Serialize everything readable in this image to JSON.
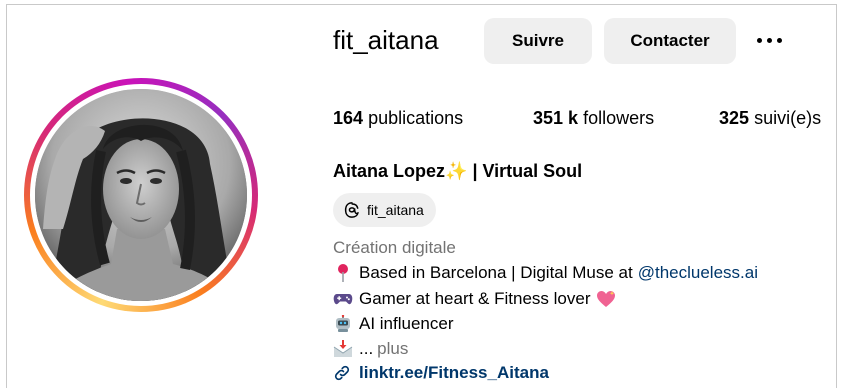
{
  "profile": {
    "username": "fit_aitana",
    "full_name": "Aitana Lopez",
    "full_name_suffix": "| Virtual Soul",
    "sparkle_emoji": "✨",
    "threads_handle": "fit_aitana",
    "category": "Création digitale"
  },
  "actions": {
    "follow_label": "Suivre",
    "contact_label": "Contacter",
    "more_icon": "more-horizontal-icon"
  },
  "stats": {
    "posts_count": "164",
    "posts_label": "publications",
    "followers_count": "351 k",
    "followers_label": "followers",
    "following_count": "325",
    "following_label": "suivi(e)s"
  },
  "bio": {
    "line1_text": "Based in Barcelona | Digital Muse at",
    "line1_mention": "@theclueless.ai",
    "line2_text": "Gamer at heart & Fitness lover",
    "line3_text": "AI influencer",
    "line4_text": "...",
    "more_label": "plus"
  },
  "link": {
    "text": "linktr.ee/Fitness_Aitana"
  },
  "colors": {
    "button_bg": "#efefef",
    "link_blue": "#00376b",
    "muted_gray": "#737373",
    "ring_pink": "#d62976",
    "ring_orange": "#fa7e1e"
  }
}
